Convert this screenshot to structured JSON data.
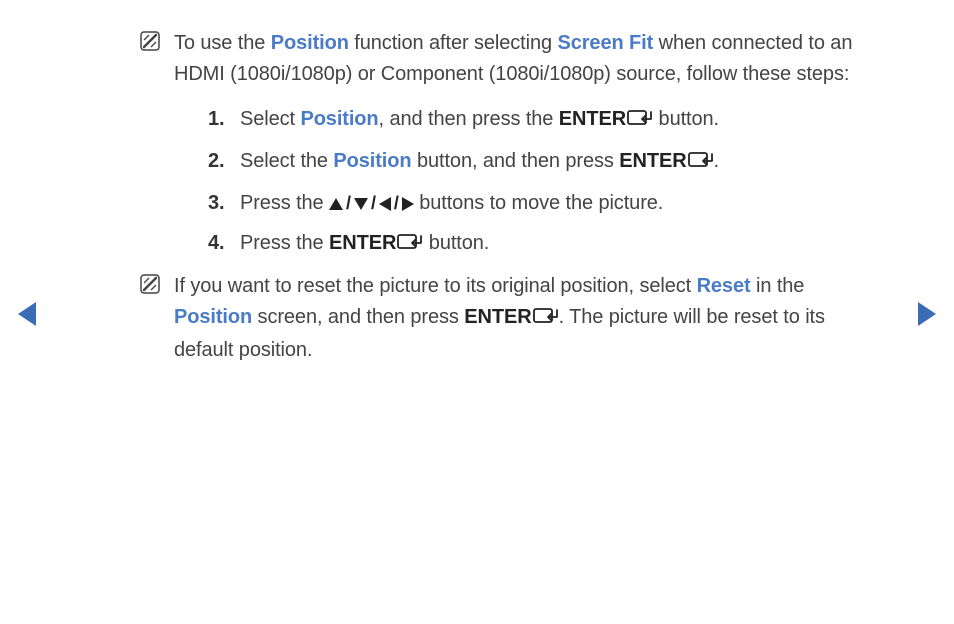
{
  "note1": {
    "text_parts": {
      "p1": "To use the ",
      "p2": "Position",
      "p3": " function after selecting ",
      "p4": "Screen Fit",
      "p5": " when connected to an HDMI (1080i/1080p) or Component (1080i/1080p) source, follow these steps:"
    }
  },
  "steps": {
    "s1": {
      "p1": "Select ",
      "p2": "Position",
      "p3": ", and then press the ",
      "p4": "ENTER",
      "p5": " button."
    },
    "s2": {
      "p1": "Select the ",
      "p2": "Position",
      "p3": " button, and then press ",
      "p4": "ENTER",
      "p5": "."
    },
    "s3": {
      "p1": "Press the ",
      "p2": " buttons to move the picture."
    },
    "s4": {
      "p1": "Press the ",
      "p2": "ENTER",
      "p3": " button."
    }
  },
  "note2": {
    "p1": "If you want to reset the picture to its original position, select ",
    "p2": "Reset",
    "p3": " in the ",
    "p4": "Position",
    "p5": " screen, and then press ",
    "p6": "ENTER",
    "p7": ". The picture will be reset to its default position."
  }
}
